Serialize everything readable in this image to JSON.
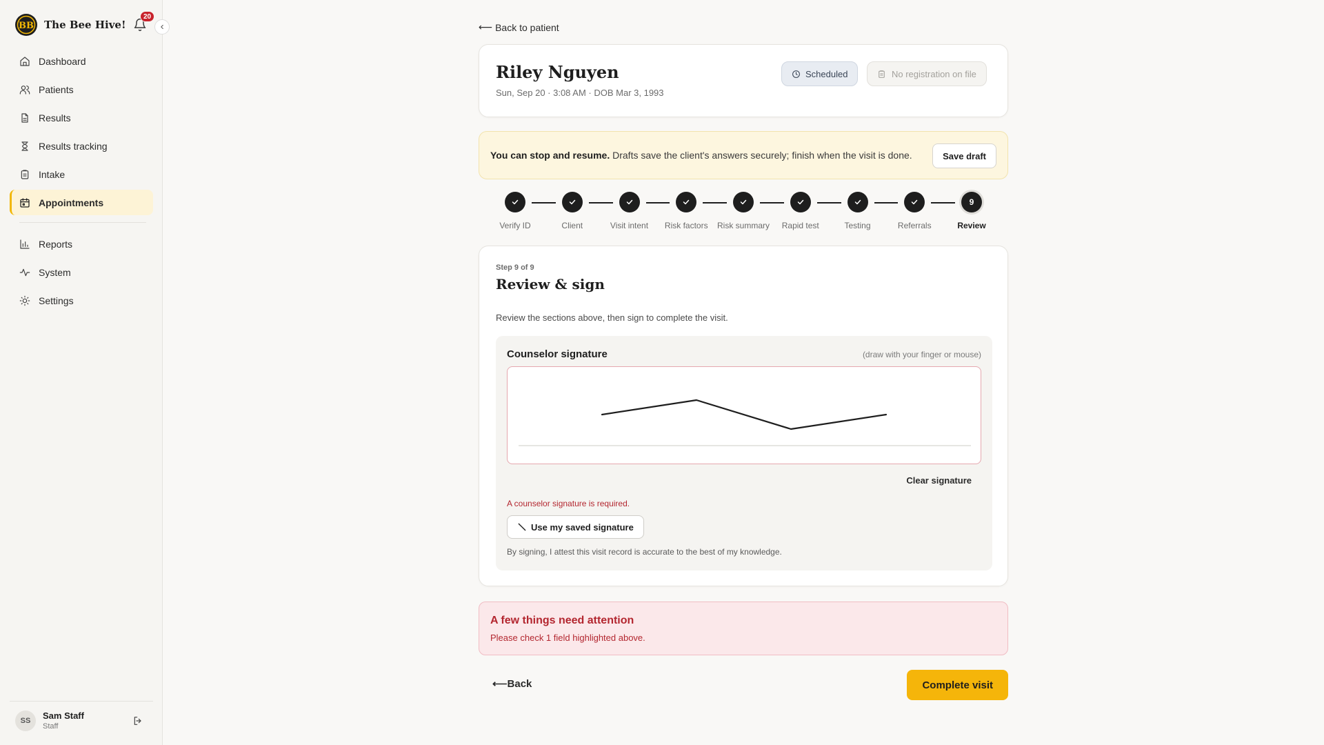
{
  "app": {
    "name": "The Bee Hive!",
    "notification_count": "20"
  },
  "sidebar": {
    "items": [
      {
        "label": "Dashboard",
        "icon": "home-icon"
      },
      {
        "label": "Patients",
        "icon": "users-icon"
      },
      {
        "label": "Results",
        "icon": "file-icon"
      },
      {
        "label": "Results tracking",
        "icon": "hourglass-icon"
      },
      {
        "label": "Intake",
        "icon": "clipboard-icon"
      },
      {
        "label": "Appointments",
        "icon": "calendar-icon",
        "active": true
      }
    ],
    "secondary": [
      {
        "label": "Reports",
        "icon": "bar-chart-icon"
      },
      {
        "label": "System",
        "icon": "activity-icon"
      },
      {
        "label": "Settings",
        "icon": "sun-icon"
      }
    ]
  },
  "user": {
    "initials": "SS",
    "name": "Sam Staff",
    "role": "Staff"
  },
  "back_to_patient": "Back to patient",
  "patient": {
    "name": "Riley Nguyen",
    "meta": "Sun, Sep 20 · 3:08 AM · DOB Mar 3, 1993",
    "status": "Scheduled",
    "registration": "No registration on file"
  },
  "notice": {
    "bold": "You can stop and resume.",
    "text": " Drafts save the client's answers securely; finish when the visit is done.",
    "save_label": "Save draft"
  },
  "steps": [
    {
      "label": "Verify ID",
      "done": true
    },
    {
      "label": "Client",
      "done": true
    },
    {
      "label": "Visit intent",
      "done": true
    },
    {
      "label": "Risk factors",
      "done": true
    },
    {
      "label": "Risk summary",
      "done": true
    },
    {
      "label": "Rapid test",
      "done": true
    },
    {
      "label": "Testing",
      "done": true
    },
    {
      "label": "Referrals",
      "done": true
    },
    {
      "label": "Review",
      "number": "9",
      "current": true
    }
  ],
  "review": {
    "step_count": "Step 9 of 9",
    "title": "Review & sign",
    "description": "Review the sections above, then sign to complete the visit.",
    "signature_title": "Counselor signature",
    "signature_hint": "(draw with your finger or mouse)",
    "clear_label": "Clear signature",
    "error": "A counselor signature is required.",
    "use_saved_label": "Use my saved signature",
    "attestation": "By signing, I attest this visit record is accurate to the best of my knowledge."
  },
  "alert": {
    "title": "A few things need attention",
    "subtitle": "Please check 1 field highlighted above."
  },
  "footer": {
    "back_label": "Back",
    "complete_label": "Complete visit"
  },
  "colors": {
    "accent": "#f5b50a",
    "error": "#b3262f",
    "active_nav_bg": "#fdf3d6"
  }
}
